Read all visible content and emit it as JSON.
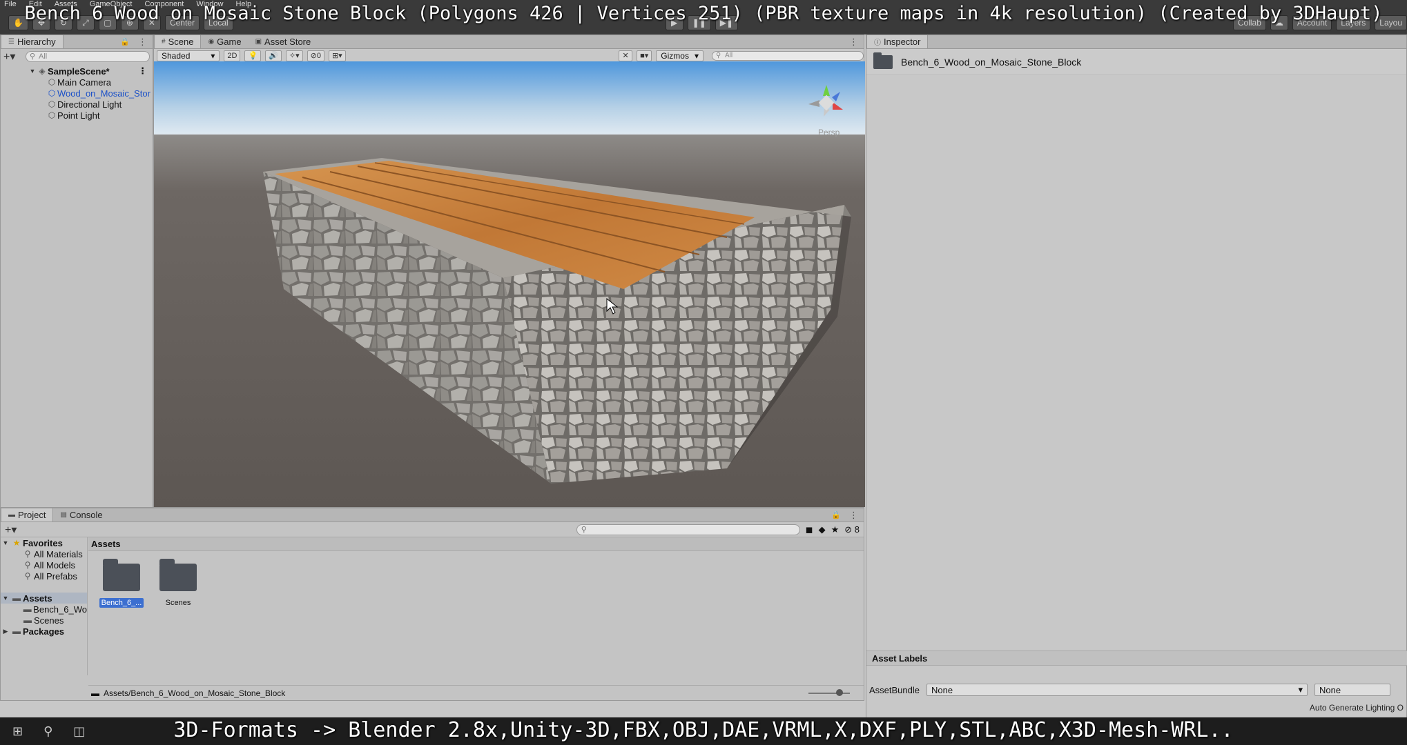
{
  "video_title": "Bench 6 Wood on Mosaic Stone Block (Polygons 426 | Vertices 251) (PBR texture maps in 4k resolution) (Created by 3DHaupt)",
  "subtitle": "3D-Formats -> Blender 2.8x,Unity-3D,FBX,OBJ,DAE,VRML,X,DXF,PLY,STL,ABC,X3D-Mesh-WRL..",
  "menu": [
    "File",
    "Edit",
    "Assets",
    "GameObject",
    "Component",
    "Window",
    "Help"
  ],
  "toolbar": {
    "center": "Center",
    "local": "Local",
    "collab": "Collab",
    "account": "Account",
    "layers": "Layers",
    "layout": "Layou"
  },
  "hierarchy": {
    "tab": "Hierarchy",
    "search_placeholder": "All",
    "scene": "SampleScene*",
    "items": [
      "Main Camera",
      "Wood_on_Mosaic_Stor",
      "Directional Light",
      "Point Light"
    ]
  },
  "scene_tabs": [
    "Scene",
    "Game",
    "Asset Store"
  ],
  "scene_toolbar": {
    "shading": "Shaded",
    "mode_2d": "2D",
    "hidden_count": "0",
    "gizmos": "Gizmos",
    "search_placeholder": "All",
    "persp": "Persp"
  },
  "inspector": {
    "tab": "Inspector",
    "asset_name": "Bench_6_Wood_on_Mosaic_Stone_Block",
    "asset_labels": "Asset Labels",
    "assetbundle_label": "AssetBundle",
    "assetbundle_value": "None",
    "variant_value": "None",
    "auto_lighting": "Auto Generate Lighting O"
  },
  "project": {
    "tabs": [
      "Project",
      "Console"
    ],
    "hidden_count": "8",
    "favorites": "Favorites",
    "favorite_items": [
      "All Materials",
      "All Models",
      "All Prefabs"
    ],
    "assets_root": "Assets",
    "assets_children": [
      "Bench_6_Wo",
      "Scenes"
    ],
    "packages": "Packages",
    "assets_header": "Assets",
    "grid_items": [
      {
        "label": "Bench_6_...",
        "selected": true
      },
      {
        "label": "Scenes",
        "selected": false
      }
    ],
    "path": "Assets/Bench_6_Wood_on_Mosaic_Stone_Block"
  },
  "colors": {
    "editor_bg": "#c2c2c2",
    "toolbar_dark": "#3a3a3a",
    "selection_blue": "#3c6fd0",
    "link_blue": "#1a50c8",
    "wood": "#c9803f",
    "stone": "#8a8782",
    "ground": "#5e5955",
    "sky_top": "#5aa0e0"
  }
}
